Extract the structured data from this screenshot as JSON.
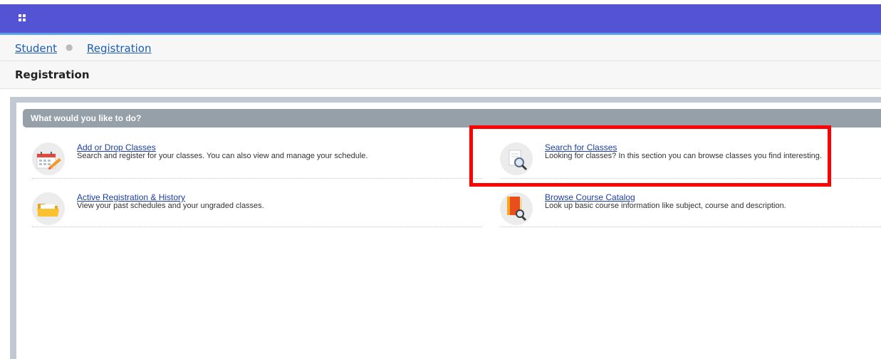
{
  "app": {
    "menu_icon": "grid-menu-icon"
  },
  "breadcrumb": {
    "items": [
      "Student",
      "Registration"
    ]
  },
  "page": {
    "title": "Registration"
  },
  "section": {
    "header": "What would you like to do?"
  },
  "actions": [
    {
      "title": "Add or Drop Classes",
      "description": "Search and register for your classes. You can also view and manage your schedule.",
      "icon": "calendar-pencil-icon"
    },
    {
      "title": "Search for Classes",
      "description": "Looking for classes? In this section you can browse classes you find interesting.",
      "icon": "document-search-icon"
    },
    {
      "title": "Active Registration & History",
      "description": "View your past schedules and your ungraded classes.",
      "icon": "folder-icon"
    },
    {
      "title": "Browse Course Catalog",
      "description": "Look up basic course information like subject, course and description.",
      "icon": "book-search-icon"
    }
  ],
  "colors": {
    "topbar": "#5353d3",
    "highlight": "#ff0000",
    "section_header": "#96a0a9"
  }
}
